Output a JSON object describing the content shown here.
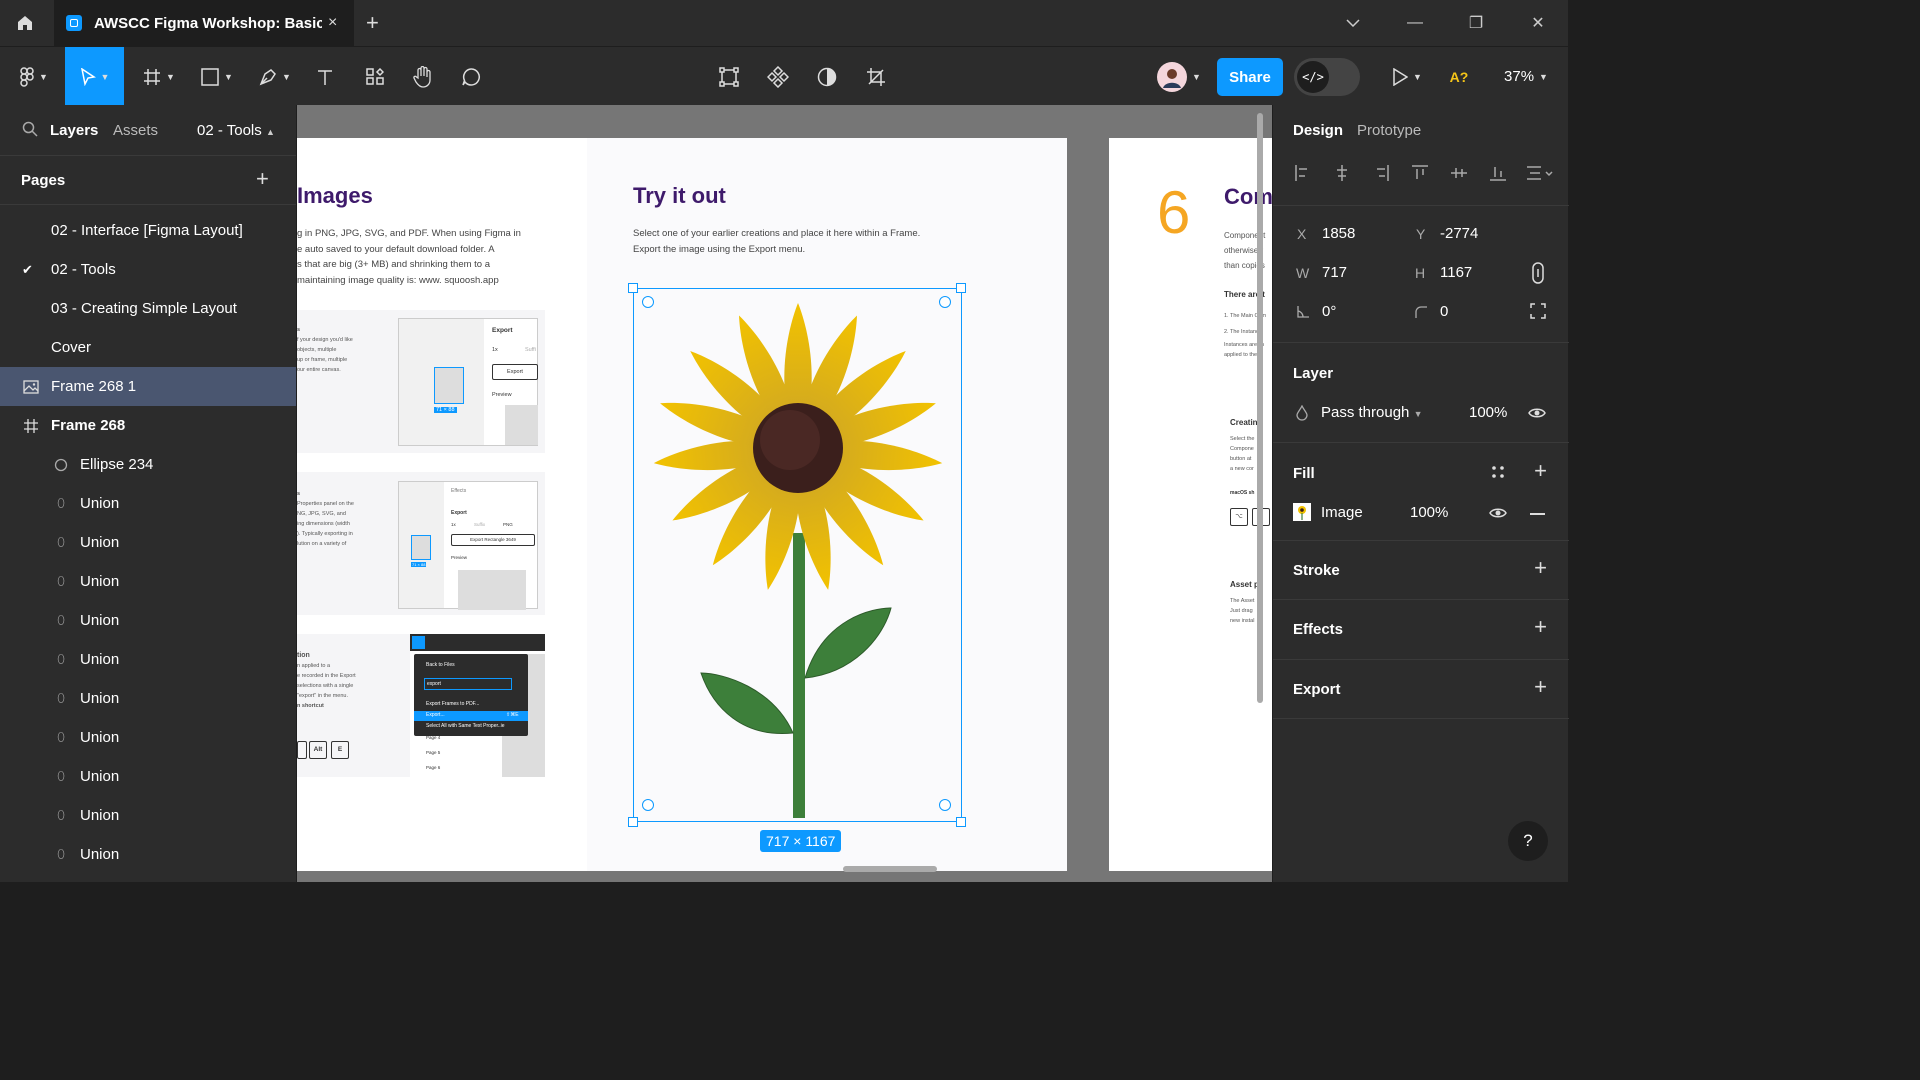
{
  "tab": {
    "title": "AWSCC Figma Workshop: Basics (C",
    "close": "×",
    "add": "+"
  },
  "window": {
    "min": "—",
    "max": "❐",
    "close": "✕",
    "dropdown": "⌄"
  },
  "toolbar": {
    "share": "Share",
    "zoom": "37%",
    "dev_label": "</>",
    "ai_label": "A?"
  },
  "left_panel": {
    "tabs": [
      "Layers",
      "Assets"
    ],
    "current_page": "02 - Tools",
    "pages_header": "Pages",
    "pages": [
      {
        "label": "02 - Interface [Figma Layout]",
        "checked": false
      },
      {
        "label": "02 - Tools",
        "checked": true
      },
      {
        "label": "03 - Creating Simple Layout",
        "checked": false
      },
      {
        "label": "Cover",
        "checked": false
      }
    ],
    "layers": [
      {
        "label": "Frame 268 1",
        "icon": "image-icon",
        "selected": true,
        "bold": false
      },
      {
        "label": "Frame 268",
        "icon": "frame-icon",
        "selected": false,
        "bold": true
      },
      {
        "label": "Ellipse 234",
        "icon": "ellipse-icon",
        "selected": false,
        "bold": false
      },
      {
        "label": "Union",
        "icon": "union-icon"
      },
      {
        "label": "Union",
        "icon": "union-icon"
      },
      {
        "label": "Union",
        "icon": "union-icon"
      },
      {
        "label": "Union",
        "icon": "union-icon"
      },
      {
        "label": "Union",
        "icon": "union-icon"
      },
      {
        "label": "Union",
        "icon": "union-icon"
      },
      {
        "label": "Union",
        "icon": "union-icon"
      },
      {
        "label": "Union",
        "icon": "union-icon"
      },
      {
        "label": "Union",
        "icon": "union-icon"
      },
      {
        "label": "Union",
        "icon": "union-icon"
      }
    ]
  },
  "canvas": {
    "left_frame": {
      "title": "Images",
      "body": [
        "g in PNG, JPG, SVG, and PDF. When using Figma in",
        "e auto saved to your default download folder. A",
        "s that are big (3+ MB) and shrinking them to a",
        " maintaining image quality is: www. squoosh.app"
      ],
      "card1_text": [
        "s",
        "f your design you'd like",
        "",
        " objects, multiple",
        "up or frame, multiple",
        "our entire canvas."
      ],
      "card1_mock": {
        "title": "Export",
        "scale": "1x",
        "suffix": "Suffi",
        "btn": "Export",
        "preview": "Preview",
        "size": "71 × 88"
      },
      "card2_text": [
        "s",
        "Properties panel on the",
        "",
        "NG, JPG, SVG, and",
        "ing dimensions (width",
        "). Typically exporting in",
        "lution on a variety of"
      ],
      "card2_mock": {
        "effects": "Effects",
        "export": "Export",
        "scale": "1x",
        "suffix": "Suffix",
        "fmt": "PNG",
        "btn": "Export Rectangle 3649",
        "preview": "Preview",
        "size": "71 × 88"
      },
      "card3_text": [
        "tion",
        "n applied to a",
        "e recorded in the Export",
        "selections with a single",
        "\"export\" in the menu.",
        "",
        "n shortcut"
      ],
      "card3_keys": [
        "Alt",
        "E"
      ],
      "card3_menu": {
        "back": "Back to Files",
        "search": "export",
        "item1": "Export Frames to PDF...",
        "item2": "Export...",
        "item2_sc": "⇧⌘E",
        "item3": "Select All with Same Text Proper..ie",
        "p4": "Page 4",
        "p5": "Page 5",
        "p6": "Page 6"
      }
    },
    "mid_frame": {
      "title": "Try it out",
      "body": [
        "Select one of your earlier creations and place it here within a Frame.",
        "Export the image using the Export menu."
      ],
      "size_badge": "717 × 1167"
    },
    "right_frame": {
      "number": "6",
      "title": "Com",
      "body": [
        "Component",
        "otherwise r",
        "than copies"
      ],
      "there": "There are t",
      "list": [
        "1. The Main Com",
        "2. The Instance",
        "Instances are lin",
        "applied to the In"
      ],
      "card1": {
        "title": "Creatin",
        "lines": [
          "Select the",
          "Compone",
          "button at",
          "a new cor"
        ],
        "mac": "macOS sh",
        "key": "⌥"
      },
      "card2": {
        "title": "Asset p",
        "lines": [
          "The Asset",
          "Just drag",
          "new instal"
        ]
      }
    }
  },
  "right_panel": {
    "tabs": [
      "Design",
      "Prototype"
    ],
    "x_label": "X",
    "x": "1858",
    "y_label": "Y",
    "y": "-2774",
    "w_label": "W",
    "w": "717",
    "h_label": "H",
    "h": "1167",
    "rotation": "0°",
    "radius": "0",
    "layer_header": "Layer",
    "blend": "Pass through",
    "opacity": "100%",
    "fill_header": "Fill",
    "fill_type": "Image",
    "fill_opacity": "100%",
    "stroke_header": "Stroke",
    "effects_header": "Effects",
    "export_header": "Export",
    "help": "?"
  },
  "colors": {
    "accent": "#0d99ff",
    "panel": "#2c2c2c",
    "canvas": "#767676",
    "selection": "#4a5670",
    "purple_title": "#3e1a6b",
    "orange_number": "#f5a623"
  }
}
